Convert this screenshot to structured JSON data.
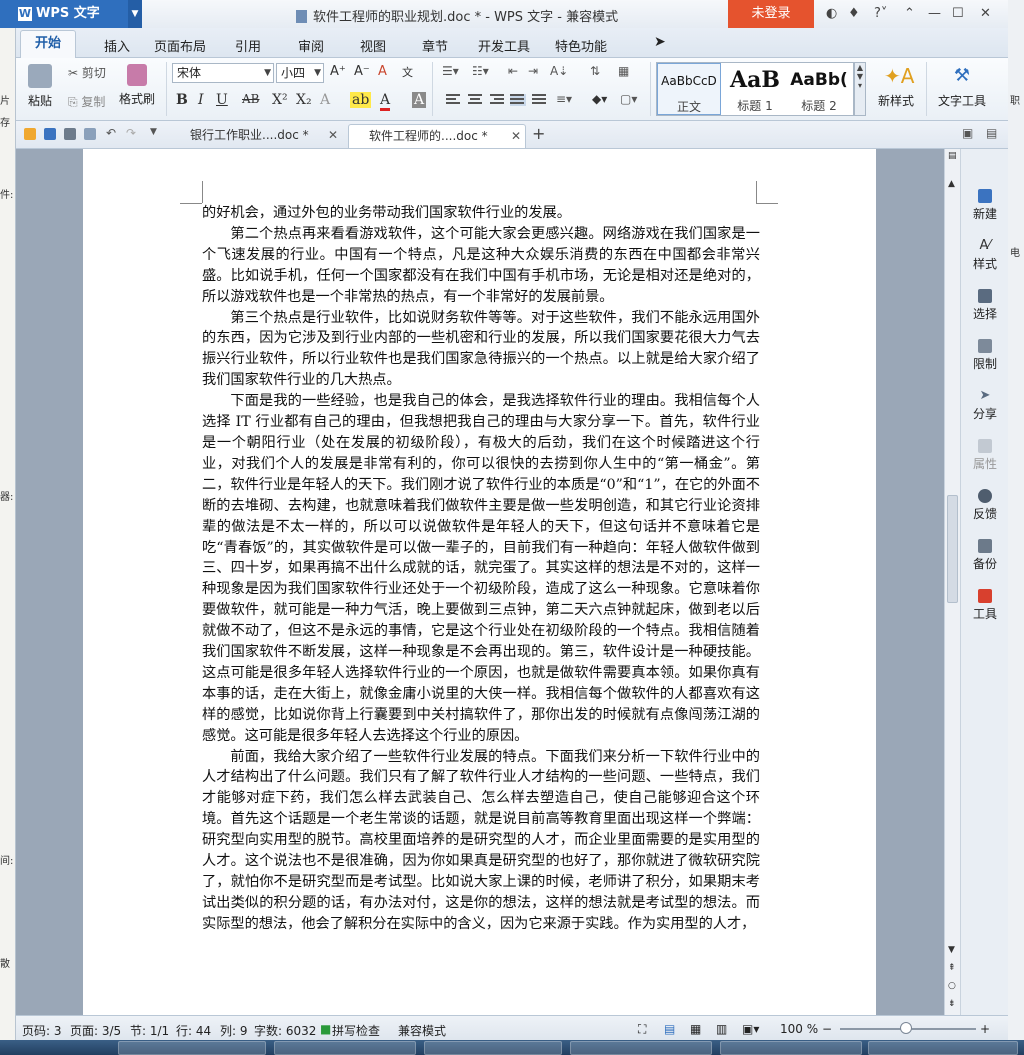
{
  "window": {
    "app_name": "WPS 文字",
    "title": "软件工程师的职业规划.doc * - WPS 文字 - 兼容模式",
    "login_button": "未登录",
    "help_label": "?"
  },
  "ribbon_tabs": [
    "开始",
    "插入",
    "页面布局",
    "引用",
    "审阅",
    "视图",
    "章节",
    "开发工具",
    "特色功能"
  ],
  "clipboard": {
    "paste": "粘贴",
    "cut": "剪切",
    "copy": "复制",
    "format_painter": "格式刷"
  },
  "font": {
    "name": "宋体",
    "size": "小四"
  },
  "format_buttons": {
    "bold": "B",
    "italic": "I",
    "underline": "U",
    "strike": "AB",
    "superscript": "X²",
    "subscript": "X₂",
    "font_color": "A"
  },
  "styles": [
    {
      "preview": "AaBbCcD",
      "name": "正文"
    },
    {
      "preview": "AaB",
      "name": "标题 1"
    },
    {
      "preview": "AaBb(",
      "name": "标题 2"
    }
  ],
  "ribbon_right": {
    "new_style": "新样式",
    "text_tools": "文字工具"
  },
  "doc_tabs": [
    {
      "label": "银行工作职业....doc *"
    },
    {
      "label": "软件工程师的....doc *"
    }
  ],
  "document_paragraphs": [
    "的好机会，通过外包的业务带动我们国家软件行业的发展。",
    "第二个热点再来看看游戏软件，这个可能大家会更感兴趣。网络游戏在我们国家是一个飞速发展的行业。中国有一个特点，凡是这种大众娱乐消费的东西在中国都会非常兴盛。比如说手机，任何一个国家都没有在我们中国有手机市场，无论是相对还是绝对的，所以游戏软件也是一个非常热的热点，有一个非常好的发展前景。",
    "第三个热点是行业软件，比如说财务软件等等。对于这些软件，我们不能永远用国外的东西，因为它涉及到行业内部的一些机密和行业的发展，所以我们国家要花很大力气去振兴行业软件，所以行业软件也是我们国家急待振兴的一个热点。以上就是给大家介绍了我们国家软件行业的几大热点。",
    "下面是我的一些经验，也是我自己的体会，是我选择软件行业的理由。我相信每个人选择 IT 行业都有自己的理由，但我想把我自己的理由与大家分享一下。首先，软件行业是一个朝阳行业（处在发展的初级阶段），有极大的后劲，我们在这个时候踏进这个行业，对我们个人的发展是非常有利的，你可以很快的去捞到你人生中的“第一桶金”。第二，软件行业是年轻人的天下。我们刚才说了软件行业的本质是“0”和“1”，在它的外面不断的去堆砌、去构建，也就意味着我们做软件主要是做一些发明创造，和其它行业论资排辈的做法是不太一样的，所以可以说做软件是年轻人的天下，但这句话并不意味着它是吃“青春饭”的，其实做软件是可以做一辈子的，目前我们有一种趋向：年轻人做软件做到三、四十岁，如果再搞不出什么成就的话，就完蛋了。其实这样的想法是不对的，这样一种现象是因为我们国家软件行业还处于一个初级阶段，造成了这么一种现象。它意味着你要做软件，就可能是一种力气活，晚上要做到三点钟，第二天六点钟就起床，做到老以后就做不动了，但这不是永远的事情，它是这个行业处在初级阶段的一个特点。我相信随着我们国家软件不断发展，这样一种现象是不会再出现的。第三，软件设计是一种硬技能。这点可能是很多年轻人选择软件行业的一个原因，也就是做软件需要真本领。如果你真有本事的话，走在大街上，就像金庸小说里的大侠一样。我相信每个做软件的人都喜欢有这样的感觉，比如说你背上行囊要到中关村搞软件了，那你出发的时候就有点像闯荡江湖的感觉。这可能是很多年轻人去选择这个行业的原因。",
    "前面，我给大家介绍了一些软件行业发展的特点。下面我们来分析一下软件行业中的人才结构出了什么问题。我们只有了解了软件行业人才结构的一些问题、一些特点，我们才能够对症下药，我们怎么样去武装自己、怎么样去塑造自己，使自己能够迎合这个环境。首先这个话题是一个老生常谈的话题，就是说目前高等教育里面出现这样一个弊端：研究型向实用型的脱节。高校里面培养的是研究型的人才，而企业里面需要的是实用型的人才。这个说法也不是很准确，因为你如果真是研究型的也好了，那你就进了微软研究院了，就怕你不是研究型而是考试型。比如说大家上课的时候，老师讲了积分，如果期末考试出类似的积分题的话，有办法对付，这是你的想法，这样的想法就是考试型的想法。而实际型的想法，他会了解积分在实际中的含义，因为它来源于实践。作为实用型的人才，"
  ],
  "side_panel": [
    "新建",
    "样式",
    "选择",
    "限制",
    "分享",
    "属性",
    "反馈",
    "备份",
    "工具"
  ],
  "status": {
    "page": "页码: 3",
    "pages": "页面: 3/5",
    "section": "节: 1/1",
    "row": "行: 44",
    "col": "列: 9",
    "words": "字数: 6032",
    "spellcheck": "拼写检查",
    "compat": "兼容模式",
    "zoom": "100 %"
  },
  "edge_labels": {
    "left": [
      "片",
      "存",
      "件:",
      "器:",
      "间:",
      "散"
    ],
    "right": [
      "职",
      "电"
    ]
  },
  "colors": {
    "accent_blue": "#2f6fbe",
    "login_orange": "#e5532e",
    "active_tab_text": "#1f5ea8",
    "page_bg": "#ffffff",
    "workspace_bg": "#9aa7b7"
  }
}
